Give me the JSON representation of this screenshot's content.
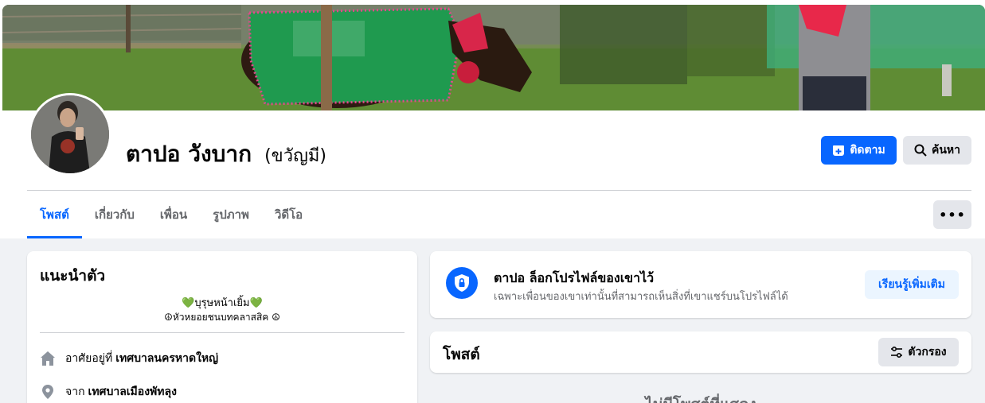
{
  "profile": {
    "name": "ตาปอ วังบาก",
    "alternate_name": "(ขวัญมี)",
    "follow_label": "ติดตาม",
    "search_label": "ค้นหา"
  },
  "tabs": [
    {
      "label": "โพสต์",
      "active": true
    },
    {
      "label": "เกี่ยวกับ",
      "active": false
    },
    {
      "label": "เพื่อน",
      "active": false
    },
    {
      "label": "รูปภาพ",
      "active": false
    },
    {
      "label": "วิดีโอ",
      "active": false
    }
  ],
  "more_label": "•••",
  "intro": {
    "title": "แนะนำตัว",
    "bio_line1": "บุรุษหน้าเยิ้ม",
    "bio_heart": "💚",
    "bio_line2": "☮หัวหยอยชนบทคลาสสิค ☮",
    "lives_prefix": "อาศัยอยู่ที่",
    "lives_value": "เทศบาลนครหาดใหญ่",
    "from_prefix": "จาก",
    "from_value": "เทศบาลเมืองพัทลุง"
  },
  "lock_notice": {
    "title": "ตาปอ ล็อกโปรไฟล์ของเขาไว้",
    "subtitle": "เฉพาะเพื่อนของเขาเท่านั้นที่สามารถเห็นสิ่งที่เขาแชร์บนโปรไฟล์ได้",
    "learn_more_label": "เรียนรู้เพิ่มเติม"
  },
  "posts": {
    "title": "โพสต์",
    "filter_label": "ตัวกรอง",
    "empty_text": "ไม่มีโพสต์ที่แสดง"
  },
  "colors": {
    "accent": "#0866ff",
    "heart": "#1ec85a"
  }
}
